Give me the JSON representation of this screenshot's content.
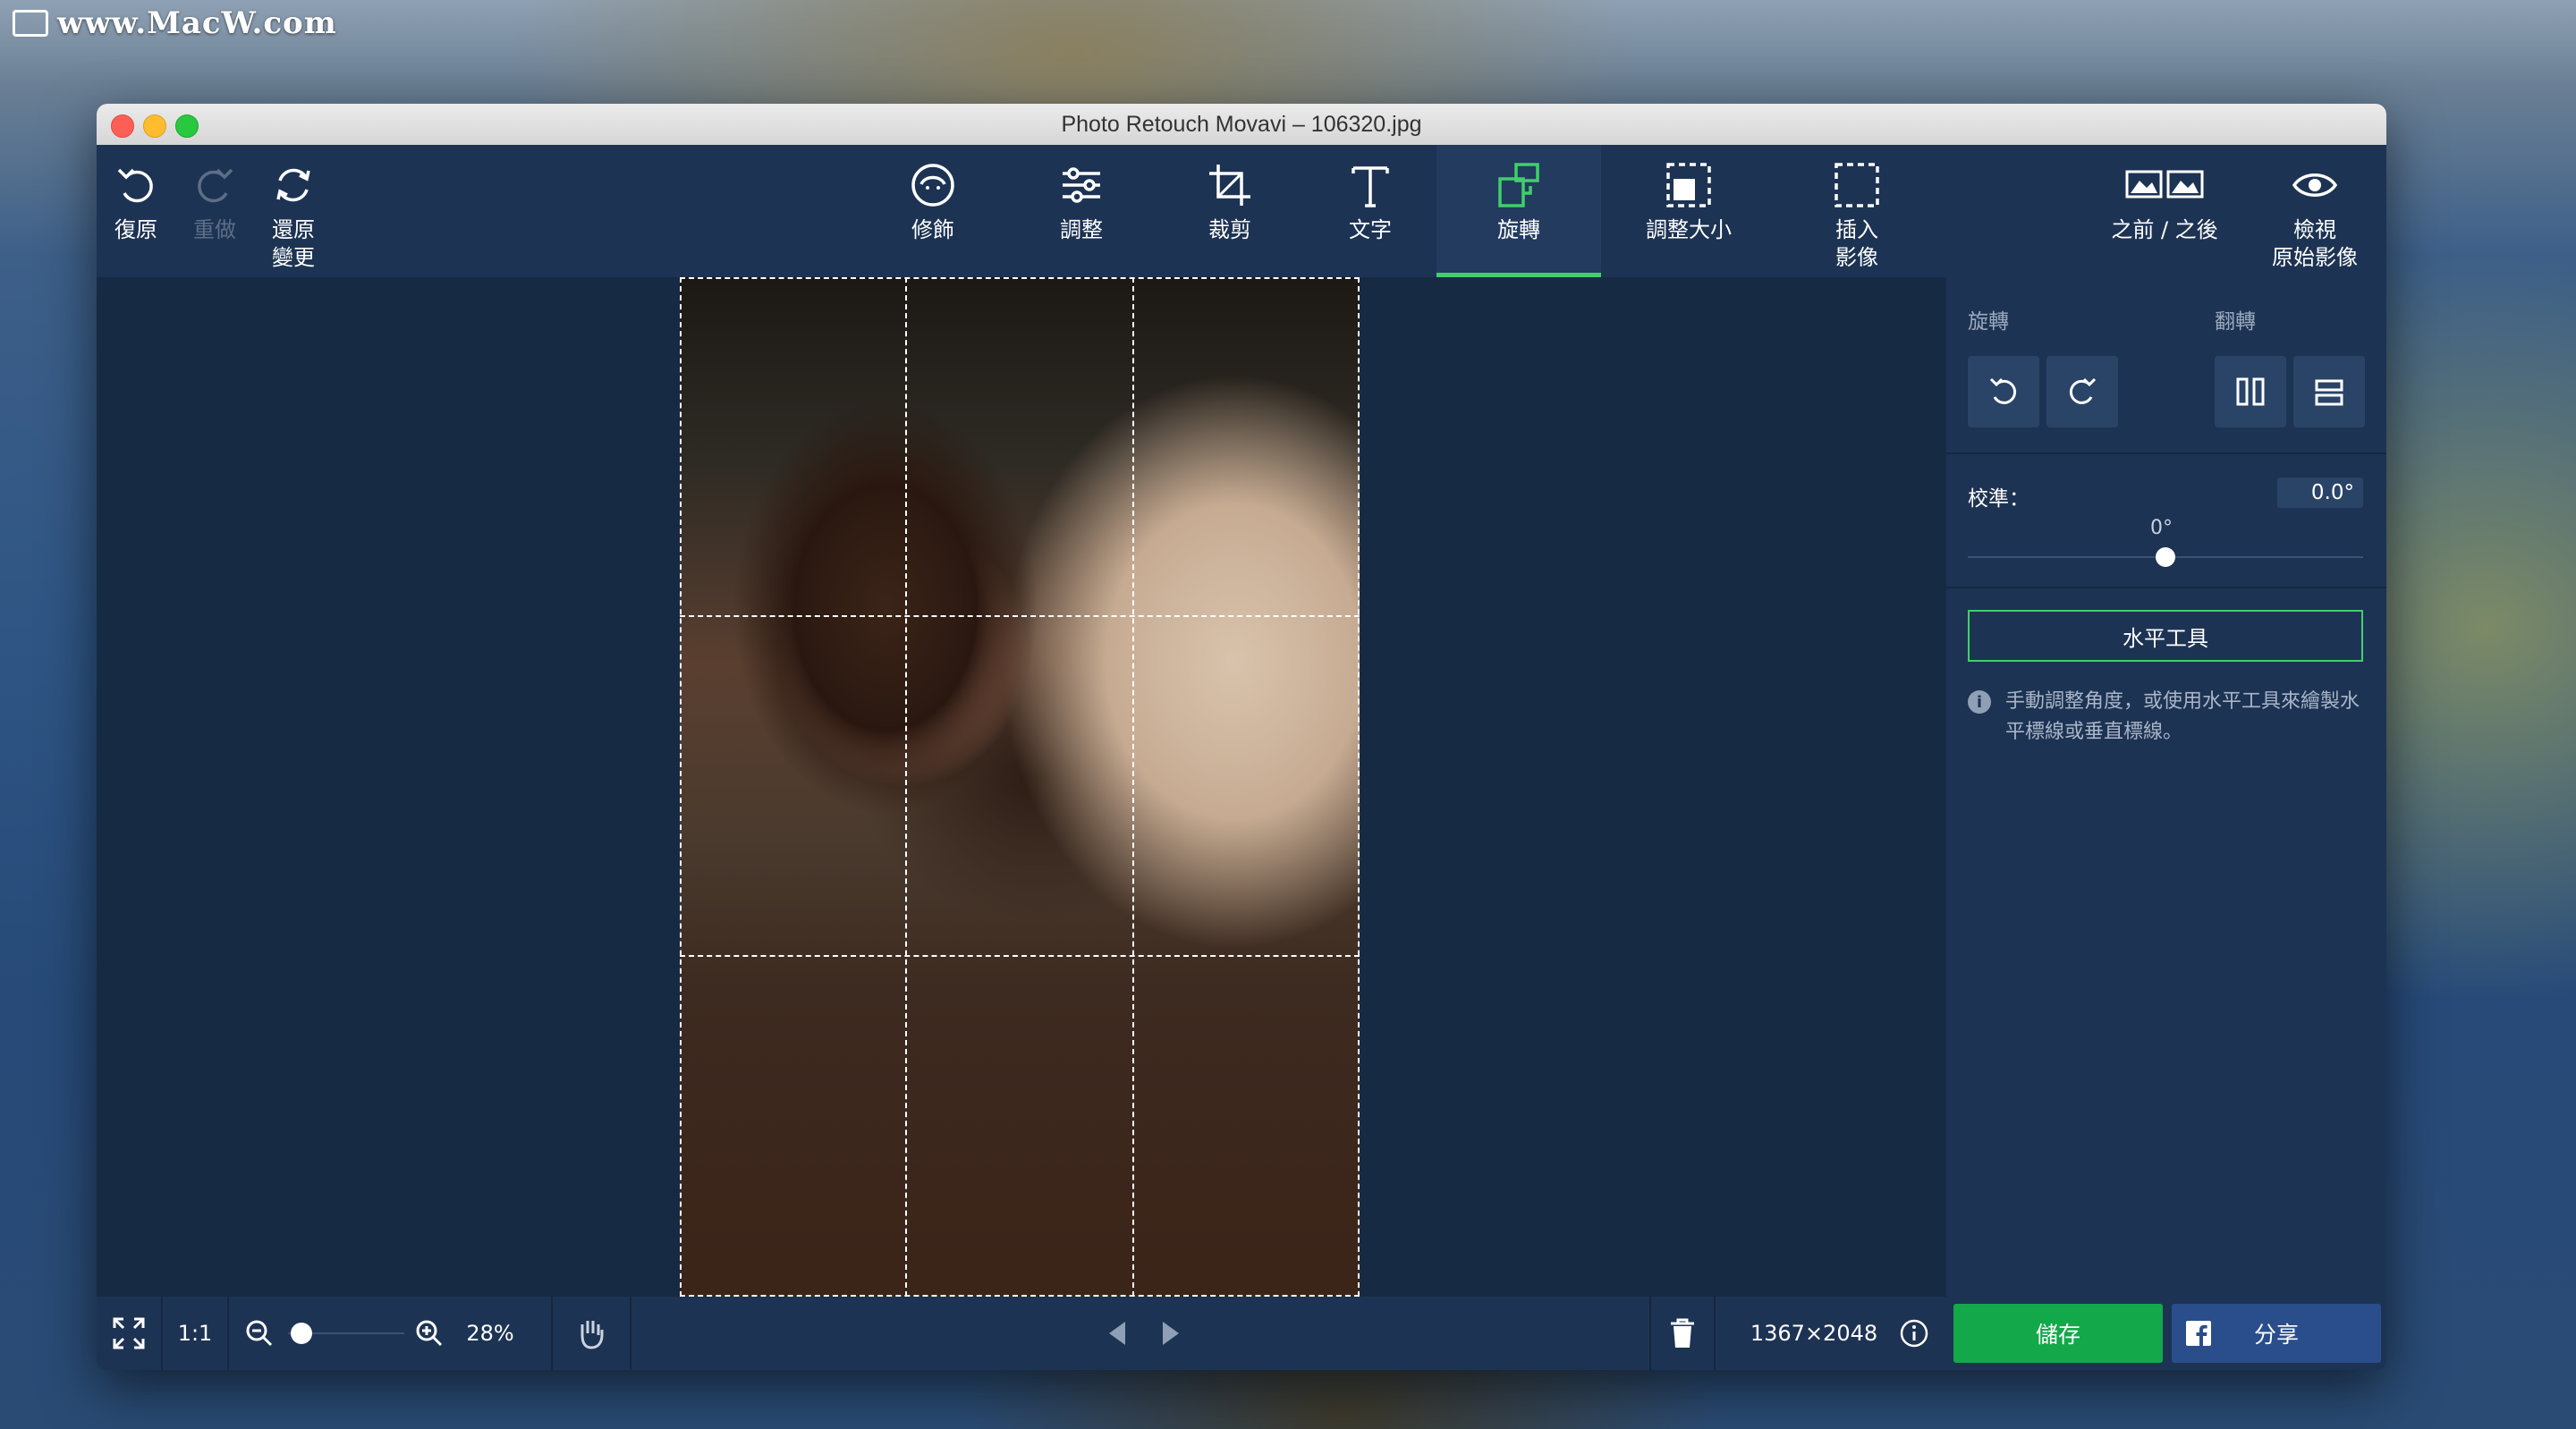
{
  "watermark": {
    "text": "www.MacW.com"
  },
  "window": {
    "title": "Photo Retouch Movavi – 106320.jpg"
  },
  "toolbar": {
    "undo": "復原",
    "redo": "重做",
    "reset": "還原\n變更",
    "retouch": "修飾",
    "adjust": "調整",
    "crop": "裁剪",
    "text": "文字",
    "rotate": "旋轉",
    "resize": "調整大小",
    "insert": "插入\n影像",
    "before_after": "之前 / 之後",
    "view_original": "檢視\n原始影像"
  },
  "sidebar": {
    "rotate_header": "旋轉",
    "flip_header": "翻轉",
    "straighten_label": "校準：",
    "straighten_value": "0.0°",
    "slider_value_label": "0°",
    "slider_value": 0,
    "level_tool_button": "水平工具",
    "info_text": "手動調整角度，或使用水平工具來繪製水平標線或垂直標線。"
  },
  "bottombar": {
    "ratio": "1:1",
    "zoom": "28%",
    "zoom_fraction": 0.02,
    "dimensions": "1367×2048",
    "save": "儲存",
    "share": "分享"
  },
  "colors": {
    "accent_green": "#3fd06a",
    "save_green": "#13a84a",
    "share_blue": "#2a4d8c",
    "panel": "#1d3353",
    "canvas": "#172a44"
  }
}
